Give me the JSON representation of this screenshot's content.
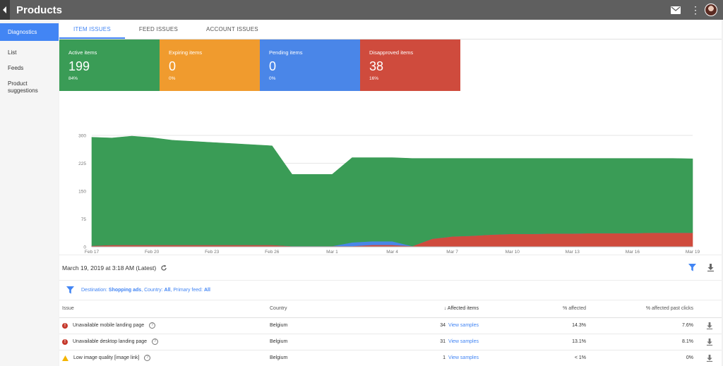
{
  "app": {
    "title": "Products"
  },
  "sidebar": {
    "items": [
      {
        "label": "Diagnostics",
        "active": true
      },
      {
        "label": "List"
      },
      {
        "label": "Feeds"
      },
      {
        "label": "Product suggestions"
      }
    ]
  },
  "tabs": [
    {
      "label": "ITEM ISSUES",
      "active": true
    },
    {
      "label": "FEED ISSUES"
    },
    {
      "label": "ACCOUNT ISSUES"
    }
  ],
  "cards": [
    {
      "label": "Active items",
      "value": "199",
      "pct": "84%",
      "color": "#3a9c56"
    },
    {
      "label": "Expiring items",
      "value": "0",
      "pct": "0%",
      "color": "#f09b2e"
    },
    {
      "label": "Pending items",
      "value": "0",
      "pct": "0%",
      "color": "#4a86e8"
    },
    {
      "label": "Disapproved items",
      "value": "38",
      "pct": "16%",
      "color": "#cf4b3d"
    }
  ],
  "chart_data": {
    "type": "area",
    "stacked": true,
    "x": [
      "Feb 17",
      "Feb 18",
      "Feb 19",
      "Feb 20",
      "Feb 21",
      "Feb 22",
      "Feb 23",
      "Feb 24",
      "Feb 25",
      "Feb 26",
      "Feb 27",
      "Feb 28",
      "Mar 1",
      "Mar 2",
      "Mar 3",
      "Mar 4",
      "Mar 5",
      "Mar 6",
      "Mar 7",
      "Mar 8",
      "Mar 9",
      "Mar 10",
      "Mar 11",
      "Mar 12",
      "Mar 13",
      "Mar 14",
      "Mar 15",
      "Mar 16",
      "Mar 17",
      "Mar 18",
      "Mar 19"
    ],
    "x_tick_labels": [
      "Feb 17",
      "Feb 20",
      "Feb 23",
      "Feb 26",
      "Mar 1",
      "Mar 4",
      "Mar 7",
      "Mar 10",
      "Mar 13",
      "Mar 16",
      "Mar 19"
    ],
    "y_ticks": [
      "0",
      "75",
      "150",
      "225",
      "300"
    ],
    "ylim": [
      0,
      300
    ],
    "grid": true,
    "series": [
      {
        "color": "#cf4b3d",
        "values": [
          3,
          5,
          5,
          5,
          5,
          5,
          5,
          5,
          5,
          5,
          2,
          2,
          2,
          2,
          5,
          5,
          2,
          22,
          28,
          30,
          33,
          35,
          35,
          36,
          36,
          37,
          37,
          37,
          38,
          38,
          38
        ]
      },
      {
        "color": "#4a86e8",
        "values": [
          0,
          0,
          0,
          0,
          0,
          0,
          0,
          0,
          0,
          0,
          0,
          0,
          0,
          10,
          10,
          10,
          0,
          0,
          0,
          0,
          0,
          0,
          0,
          0,
          0,
          0,
          0,
          0,
          0,
          0,
          0
        ]
      },
      {
        "color": "#3a9c56",
        "values": [
          292,
          288,
          293,
          289,
          282,
          279,
          276,
          273,
          270,
          267,
          193,
          193,
          193,
          228,
          225,
          225,
          236,
          216,
          210,
          208,
          205,
          203,
          203,
          202,
          202,
          201,
          201,
          201,
          200,
          200,
          199
        ]
      }
    ]
  },
  "date_bar": {
    "text": "March 19, 2019 at 3:18 AM (Latest)"
  },
  "filter": {
    "dest_label": "Destination:",
    "dest_value": "Shopping ads",
    "country_label": ", Country:",
    "country_value": "All",
    "feed_label": ", Primary feed:",
    "feed_value": "All"
  },
  "table": {
    "headers": {
      "issue": "Issue",
      "country": "Country",
      "affected": "Affected items",
      "pct": "% affected",
      "clicks": "% affected past clicks"
    },
    "rows": [
      {
        "icon": "error",
        "issue": "Unavailable mobile landing page",
        "country": "Belgium",
        "count": "34",
        "link": "View samples",
        "pct": "14.3%",
        "clicks": "7.6%"
      },
      {
        "icon": "error",
        "issue": "Unavailable desktop landing page",
        "country": "Belgium",
        "count": "31",
        "link": "View samples",
        "pct": "13.1%",
        "clicks": "8.1%"
      },
      {
        "icon": "warning",
        "issue": "Low image quality [image link]",
        "country": "Belgium",
        "count": "1",
        "link": "View samples",
        "pct": "< 1%",
        "clicks": "0%"
      }
    ]
  },
  "colors": {
    "accent": "#4285f4",
    "appbar": "#5f5f5f"
  }
}
